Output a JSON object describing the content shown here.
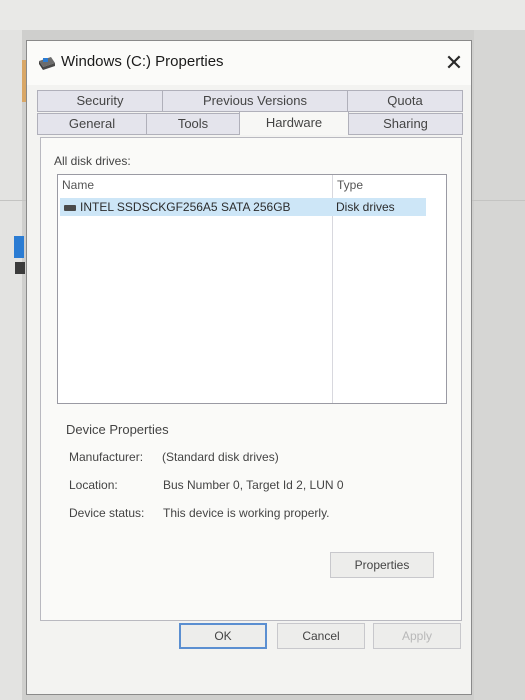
{
  "window": {
    "title": "Windows (C:) Properties",
    "close_glyph": "✕"
  },
  "tabs": {
    "row_back": [
      "Security",
      "Previous Versions",
      "Quota"
    ],
    "row_front": [
      "General",
      "Tools",
      "Hardware",
      "Sharing"
    ],
    "active": "Hardware"
  },
  "hardware": {
    "all_disk_drives_label": "All disk drives:",
    "columns": {
      "name": "Name",
      "type": "Type"
    },
    "drives": [
      {
        "name": "INTEL SSDSCKGF256A5 SATA 256GB",
        "type": "Disk drives"
      }
    ],
    "device_properties": {
      "heading": "Device Properties",
      "manufacturer_label": "Manufacturer:",
      "manufacturer_value": "(Standard disk drives)",
      "location_label": "Location:",
      "location_value": "Bus Number 0, Target Id 2, LUN 0",
      "status_label": "Device status:",
      "status_value": "This device is working properly."
    },
    "properties_button": "Properties"
  },
  "footer": {
    "ok": "OK",
    "cancel": "Cancel",
    "apply": "Apply"
  },
  "colors": {
    "selection": "#cde6f7",
    "default_button_border": "#5b8fd1"
  }
}
